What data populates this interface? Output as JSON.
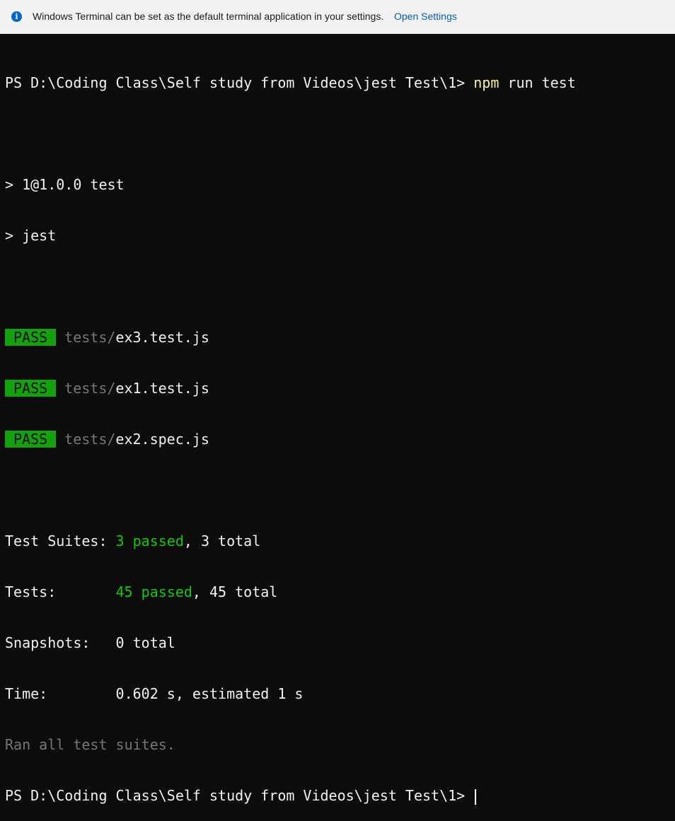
{
  "infobar": {
    "icon": "info-icon",
    "message": "Windows Terminal can be set as the default terminal application in your settings.",
    "link_label": "Open Settings",
    "accent_color": "#0067c0"
  },
  "terminal": {
    "prompt": "PS D:\\Coding Class\\Self study from Videos\\jest Test\\1> ",
    "command_bin": "npm",
    "command_args": " run test",
    "script_line1": "> 1@1.0.0 test",
    "script_line2": "> jest",
    "results": [
      {
        "badge": "PASS",
        "dir": "tests/",
        "file": "ex3.test.js"
      },
      {
        "badge": "PASS",
        "dir": "tests/",
        "file": "ex1.test.js"
      },
      {
        "badge": "PASS",
        "dir": "tests/",
        "file": "ex2.spec.js"
      }
    ],
    "summary": {
      "suites_label": "Test Suites: ",
      "suites_passed": "3 passed",
      "suites_total": ", 3 total",
      "tests_label": "Tests:       ",
      "tests_passed": "45 passed",
      "tests_total": ", 45 total",
      "snapshots_label": "Snapshots:   ",
      "snapshots_value": "0 total",
      "time_label": "Time:        ",
      "time_value": "0.602 s, estimated 1 s",
      "ran_all": "Ran all test suites."
    },
    "colors": {
      "pass_badge": "#13a10e",
      "passed_text": "#16c60c",
      "command": "#f9f1a5"
    }
  }
}
